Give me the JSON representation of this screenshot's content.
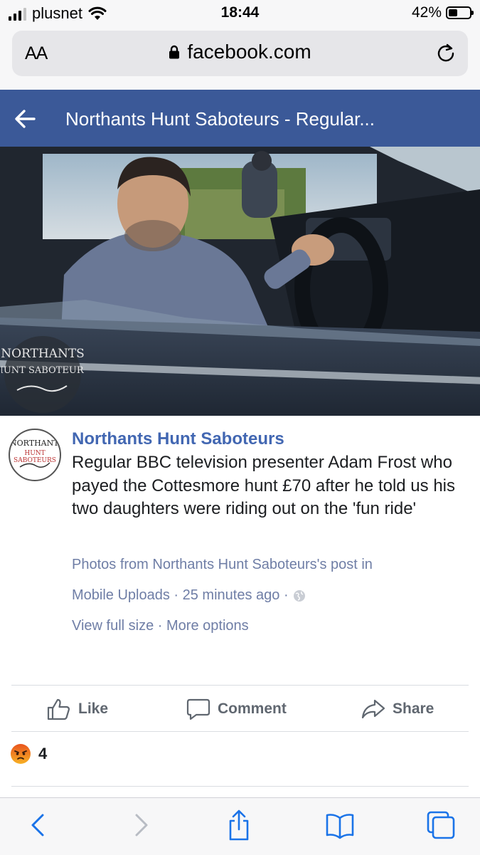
{
  "status_bar": {
    "carrier": "plusnet",
    "time": "18:44",
    "battery_percent": "42%",
    "battery_level": 0.42,
    "signal_bars": 3
  },
  "browser": {
    "text_size_label": "AA",
    "url": "facebook.com"
  },
  "header": {
    "title": "Northants Hunt Saboteurs - Regular..."
  },
  "photo": {
    "watermark_line1": "NORTHANTS",
    "watermark_line2": "HUNT SABOTEURS"
  },
  "post": {
    "author": "Northants Hunt Saboteurs",
    "avatar_line1": "NORTHANTS",
    "avatar_line2": "HUNT SABOTEURS",
    "text": "Regular BBC television presenter Adam Frost who payed the Cottesmore hunt £70 after he told us his two daughters were riding out on the 'fun ride'",
    "meta_photos_from": "Photos from Northants Hunt Saboteurs's post",
    "meta_in": " in",
    "meta_album": "Mobile Uploads",
    "meta_time": " · 25 minutes ago ·",
    "view_full_size": "View full size",
    "meta_sep": " · ",
    "more_options": "More options"
  },
  "actions": {
    "like": "Like",
    "comment": "Comment",
    "share": "Share"
  },
  "reactions": {
    "count": "4"
  },
  "colors": {
    "facebook_blue": "#3b5998",
    "link_blue": "#4267b2",
    "meta_gray": "#6f7ea6",
    "ios_blue": "#1a73e8"
  }
}
